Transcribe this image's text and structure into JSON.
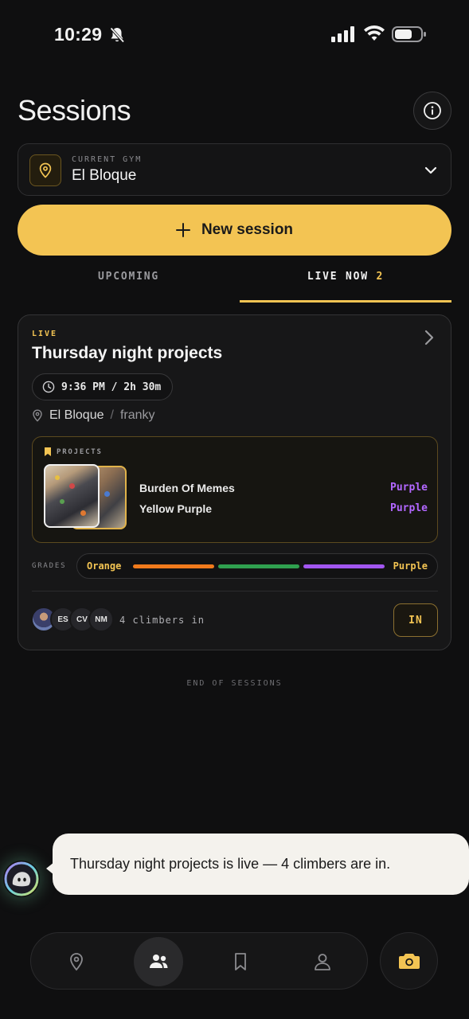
{
  "status_bar": {
    "time": "10:29"
  },
  "header": {
    "title": "Sessions"
  },
  "gym": {
    "label": "CURRENT GYM",
    "name": "El Bloque"
  },
  "actions": {
    "new_session": "New session"
  },
  "tabs": {
    "upcoming": "UPCOMING",
    "live": "LIVE NOW",
    "live_count": "2"
  },
  "session": {
    "badge": "LIVE",
    "title": "Thursday night projects",
    "time": "9:36 PM / 2h 30m",
    "gym": "El Bloque",
    "separator": "/",
    "host": "franky",
    "projects_label": "PROJECTS",
    "projects": [
      {
        "name": "Burden Of Memes",
        "grade": "Purple"
      },
      {
        "name": "Yellow Purple",
        "grade": "Purple"
      }
    ],
    "grades_label": "GRADES",
    "grade_min": "Orange",
    "grade_max": "Purple",
    "grade_colors": [
      "#f07a1c",
      "#2fa04f",
      "#a256f0"
    ],
    "climbers": [
      "ES",
      "CV",
      "NM"
    ],
    "climbers_text": "4 climbers in",
    "join_label": "IN"
  },
  "end_label": "END OF SESSIONS",
  "toast": {
    "message": "Thursday night projects is live — 4 climbers are in."
  },
  "nav": {
    "items": [
      "map-pin-icon",
      "people-icon",
      "bookmark-icon",
      "profile-icon"
    ],
    "active": "people-icon",
    "camera": "camera-icon"
  },
  "colors": {
    "accent": "#f3c453",
    "background": "#0f0f10",
    "grade_purple": "#b267ff"
  }
}
